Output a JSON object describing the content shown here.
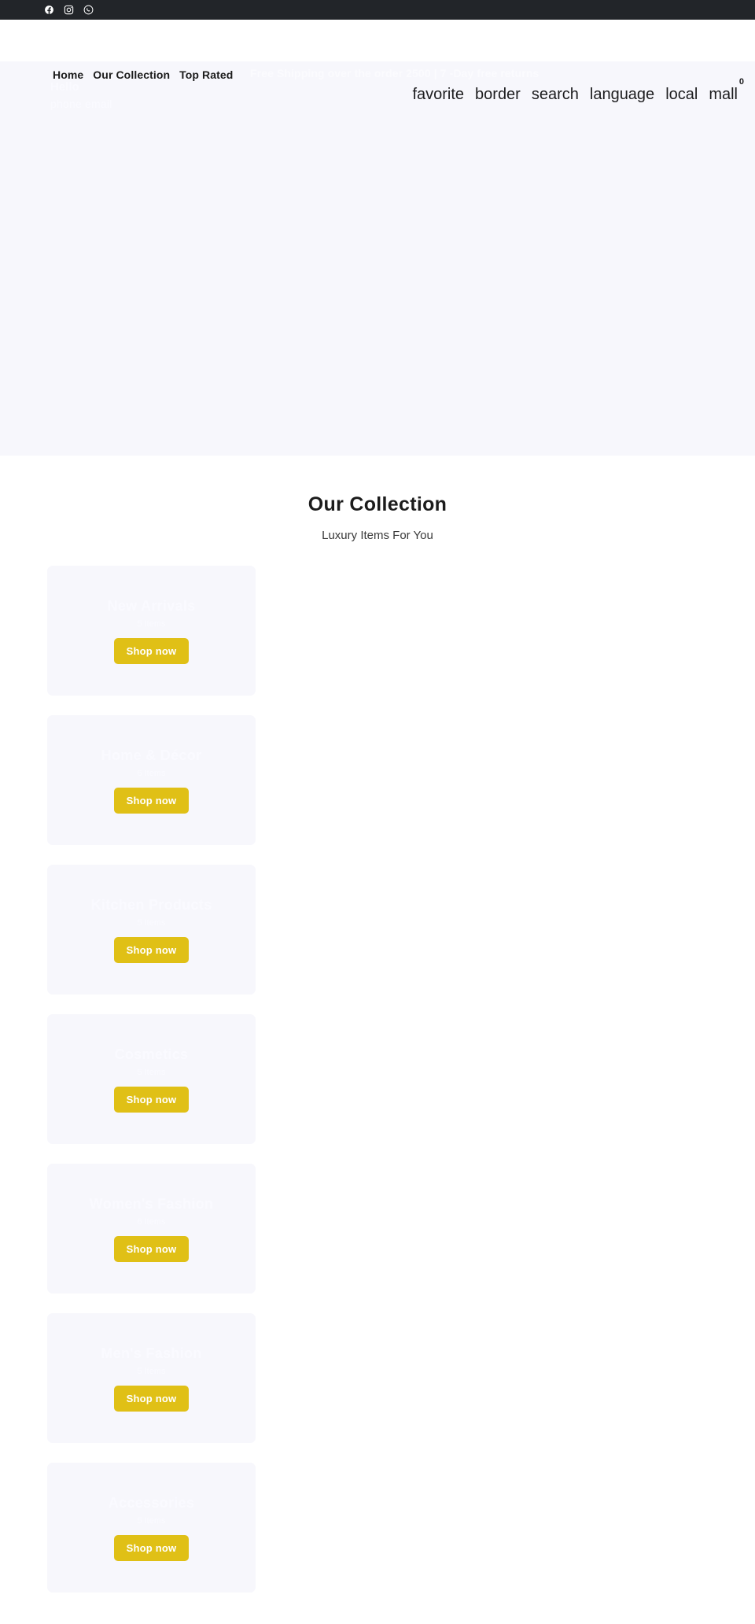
{
  "topbar": {
    "social": [
      {
        "name": "facebook-icon",
        "label": "Facebook"
      },
      {
        "name": "instagram-icon",
        "label": "Instagram"
      },
      {
        "name": "whatsapp-icon",
        "label": "WhatsApp"
      }
    ]
  },
  "header": {
    "nav": [
      {
        "label": "Home"
      },
      {
        "label": "Our Collection"
      },
      {
        "label": "Top Rated"
      }
    ],
    "promo_text": "Free Shipping over the order 2500 | 7 -Day free returns",
    "greeting": "Hello",
    "contacts": "phone  email",
    "actions": [
      {
        "name": "favorite-icon",
        "label": "favorite"
      },
      {
        "name": "border-icon",
        "label": "border"
      },
      {
        "name": "search-icon",
        "label": "search"
      },
      {
        "name": "language-icon",
        "label": "language"
      },
      {
        "name": "local-icon",
        "label": "local"
      },
      {
        "name": "cart-icon",
        "label": "mall"
      }
    ],
    "cart_count": "0"
  },
  "collection": {
    "title": "Our Collection",
    "subtitle": "Luxury Items For You",
    "shop_label": "Shop now",
    "cards": [
      {
        "title": "New Arrivals",
        "sub": "5 Items"
      },
      {
        "title": "Home & Décor",
        "sub": "6 Items"
      },
      {
        "title": "Kitchen Products",
        "sub": "5 Items"
      },
      {
        "title": "Cosmetics",
        "sub": "5 Items"
      },
      {
        "title": "Women's Fashion",
        "sub": "6 Items"
      },
      {
        "title": "Men's Fashion",
        "sub": "5 Items"
      },
      {
        "title": "Accessories",
        "sub": "5 Items"
      }
    ]
  },
  "colors": {
    "topbar_bg": "#222529",
    "hero_bg": "#f7f7fc",
    "accent": "#e0c016",
    "text": "#1c1c1c"
  }
}
